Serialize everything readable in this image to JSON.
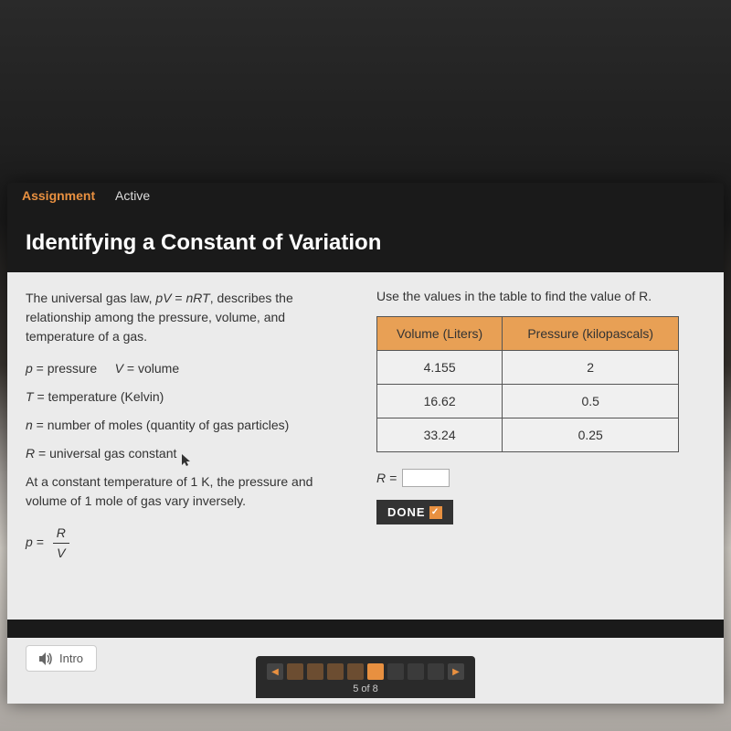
{
  "topbar": {
    "assignment": "Assignment",
    "status": "Active"
  },
  "title": "Identifying a Constant of Variation",
  "left": {
    "intro": "The universal gas law, pV = nRT, describes the relationship among the pressure, volume, and temperature of a gas.",
    "pv": "p = pressure     V = volume",
    "t": "T = temperature (Kelvin)",
    "n": "n = number of moles (quantity of gas particles)",
    "r": "R = universal gas constant",
    "const": "At a constant temperature of 1 K, the pressure and volume of 1 mole of gas vary inversely.",
    "p_eq": "p =",
    "frac_top": "R",
    "frac_bot": "V"
  },
  "right": {
    "prompt": "Use the values in the table to find the value of R.",
    "headers": {
      "vol": "Volume (Liters)",
      "pres": "Pressure (kilopascals)"
    },
    "r_label": "R =",
    "done": "DONE"
  },
  "chart_data": {
    "type": "table",
    "columns": [
      "Volume (Liters)",
      "Pressure (kilopascals)"
    ],
    "rows": [
      {
        "volume": 4.155,
        "pressure": 2
      },
      {
        "volume": 16.62,
        "pressure": 0.5
      },
      {
        "volume": 33.24,
        "pressure": 0.25
      }
    ]
  },
  "footer": {
    "intro": "Intro",
    "page_label": "5 of 8",
    "current": 5,
    "total": 8
  }
}
